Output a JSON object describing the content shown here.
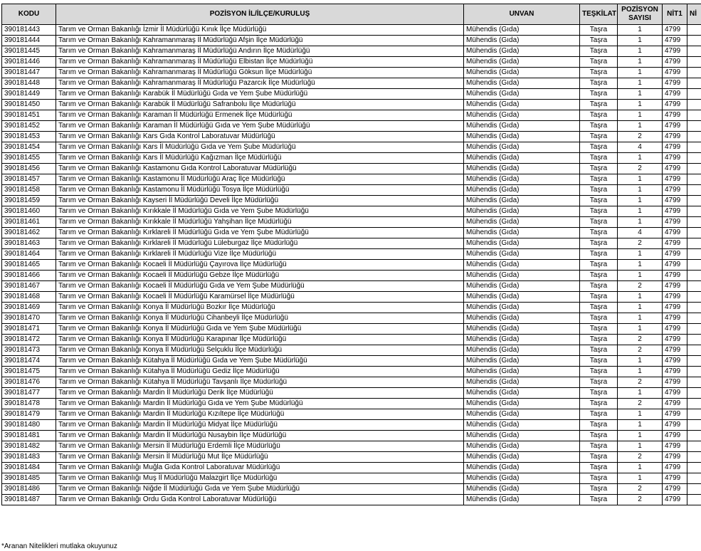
{
  "headers": {
    "kodu": "KODU",
    "pozisyon": "POZİSYON İL/İLÇE/KURULUŞ",
    "unvan": "UNVAN",
    "teskilat": "TEŞKİLAT",
    "sayisi_line1": "POZİSYON",
    "sayisi_line2": "SAYISI",
    "nit1": "NİT1",
    "nit2": "Nİ"
  },
  "rows": [
    {
      "kodu": "390181443",
      "pozisyon": "Tarım ve Orman Bakanlığı İzmir İl Müdürlüğü Kınık İlçe Müdürlüğü",
      "unvan": "Mühendis (Gıda)",
      "teskilat": "Taşra",
      "sayisi": "1",
      "nit1": "4799"
    },
    {
      "kodu": "390181444",
      "pozisyon": "Tarım ve Orman Bakanlığı Kahramanmaraş İl Müdürlüğü Afşin İlçe Müdürlüğü",
      "unvan": "Mühendis (Gıda)",
      "teskilat": "Taşra",
      "sayisi": "1",
      "nit1": "4799"
    },
    {
      "kodu": "390181445",
      "pozisyon": "Tarım ve Orman Bakanlığı Kahramanmaraş İl Müdürlüğü Andırın İlçe Müdürlüğü",
      "unvan": "Mühendis (Gıda)",
      "teskilat": "Taşra",
      "sayisi": "1",
      "nit1": "4799"
    },
    {
      "kodu": "390181446",
      "pozisyon": "Tarım ve Orman Bakanlığı Kahramanmaraş İl Müdürlüğü Elbistan İlçe Müdürlüğü",
      "unvan": "Mühendis (Gıda)",
      "teskilat": "Taşra",
      "sayisi": "1",
      "nit1": "4799"
    },
    {
      "kodu": "390181447",
      "pozisyon": "Tarım ve Orman Bakanlığı Kahramanmaraş İl Müdürlüğü Göksun İlçe Müdürlüğü",
      "unvan": "Mühendis (Gıda)",
      "teskilat": "Taşra",
      "sayisi": "1",
      "nit1": "4799"
    },
    {
      "kodu": "390181448",
      "pozisyon": "Tarım ve Orman Bakanlığı Kahramanmaraş İl Müdürlüğü Pazarcık İlçe Müdürlüğü",
      "unvan": "Mühendis (Gıda)",
      "teskilat": "Taşra",
      "sayisi": "1",
      "nit1": "4799"
    },
    {
      "kodu": "390181449",
      "pozisyon": "Tarım ve Orman Bakanlığı Karabük İl Müdürlüğü Gıda ve Yem Şube Müdürlüğü",
      "unvan": "Mühendis (Gıda)",
      "teskilat": "Taşra",
      "sayisi": "1",
      "nit1": "4799"
    },
    {
      "kodu": "390181450",
      "pozisyon": "Tarım ve Orman Bakanlığı Karabük İl Müdürlüğü Safranbolu İlçe Müdürlüğü",
      "unvan": "Mühendis (Gıda)",
      "teskilat": "Taşra",
      "sayisi": "1",
      "nit1": "4799"
    },
    {
      "kodu": "390181451",
      "pozisyon": "Tarım ve Orman Bakanlığı Karaman İl Müdürlüğü Ermenek İlçe Müdürlüğü",
      "unvan": "Mühendis (Gıda)",
      "teskilat": "Taşra",
      "sayisi": "1",
      "nit1": "4799"
    },
    {
      "kodu": "390181452",
      "pozisyon": "Tarım ve Orman Bakanlığı Karaman İl Müdürlüğü Gıda ve Yem Şube Müdürlüğü",
      "unvan": "Mühendis (Gıda)",
      "teskilat": "Taşra",
      "sayisi": "1",
      "nit1": "4799"
    },
    {
      "kodu": "390181453",
      "pozisyon": "Tarım ve Orman Bakanlığı Kars Gıda Kontrol Laboratuvar Müdürlüğü",
      "unvan": "Mühendis (Gıda)",
      "teskilat": "Taşra",
      "sayisi": "2",
      "nit1": "4799"
    },
    {
      "kodu": "390181454",
      "pozisyon": "Tarım ve Orman Bakanlığı Kars İl Müdürlüğü Gıda ve Yem Şube Müdürlüğü",
      "unvan": "Mühendis (Gıda)",
      "teskilat": "Taşra",
      "sayisi": "4",
      "nit1": "4799"
    },
    {
      "kodu": "390181455",
      "pozisyon": "Tarım ve Orman Bakanlığı Kars İl Müdürlüğü Kağızman İlçe Müdürlüğü",
      "unvan": "Mühendis (Gıda)",
      "teskilat": "Taşra",
      "sayisi": "1",
      "nit1": "4799"
    },
    {
      "kodu": "390181456",
      "pozisyon": "Tarım ve Orman Bakanlığı Kastamonu Gıda Kontrol Laboratuvar Müdürlüğü",
      "unvan": "Mühendis (Gıda)",
      "teskilat": "Taşra",
      "sayisi": "2",
      "nit1": "4799"
    },
    {
      "kodu": "390181457",
      "pozisyon": "Tarım ve Orman Bakanlığı Kastamonu İl Müdürlüğü Araç İlçe Müdürlüğü",
      "unvan": "Mühendis (Gıda)",
      "teskilat": "Taşra",
      "sayisi": "1",
      "nit1": "4799"
    },
    {
      "kodu": "390181458",
      "pozisyon": "Tarım ve Orman Bakanlığı Kastamonu İl Müdürlüğü Tosya İlçe Müdürlüğü",
      "unvan": "Mühendis (Gıda)",
      "teskilat": "Taşra",
      "sayisi": "1",
      "nit1": "4799"
    },
    {
      "kodu": "390181459",
      "pozisyon": "Tarım ve Orman Bakanlığı Kayseri İl Müdürlüğü Develi İlçe Müdürlüğü",
      "unvan": "Mühendis (Gıda)",
      "teskilat": "Taşra",
      "sayisi": "1",
      "nit1": "4799"
    },
    {
      "kodu": "390181460",
      "pozisyon": "Tarım ve Orman Bakanlığı Kırıkkale İl Müdürlüğü Gıda ve Yem Şube Müdürlüğü",
      "unvan": "Mühendis (Gıda)",
      "teskilat": "Taşra",
      "sayisi": "1",
      "nit1": "4799"
    },
    {
      "kodu": "390181461",
      "pozisyon": "Tarım ve Orman Bakanlığı Kırıkkale İl Müdürlüğü Yahşihan İlçe Müdürlüğü",
      "unvan": "Mühendis (Gıda)",
      "teskilat": "Taşra",
      "sayisi": "1",
      "nit1": "4799"
    },
    {
      "kodu": "390181462",
      "pozisyon": "Tarım ve Orman Bakanlığı Kırklareli İl Müdürlüğü Gıda ve Yem Şube Müdürlüğü",
      "unvan": "Mühendis (Gıda)",
      "teskilat": "Taşra",
      "sayisi": "4",
      "nit1": "4799"
    },
    {
      "kodu": "390181463",
      "pozisyon": "Tarım ve Orman Bakanlığı Kırklareli İl Müdürlüğü Lüleburgaz İlçe Müdürlüğü",
      "unvan": "Mühendis (Gıda)",
      "teskilat": "Taşra",
      "sayisi": "2",
      "nit1": "4799"
    },
    {
      "kodu": "390181464",
      "pozisyon": "Tarım ve Orman Bakanlığı Kırklareli İl Müdürlüğü Vize İlçe Müdürlüğü",
      "unvan": "Mühendis (Gıda)",
      "teskilat": "Taşra",
      "sayisi": "1",
      "nit1": "4799"
    },
    {
      "kodu": "390181465",
      "pozisyon": "Tarım ve Orman Bakanlığı Kocaeli İl Müdürlüğü Çayırova İlçe Müdürlüğü",
      "unvan": "Mühendis (Gıda)",
      "teskilat": "Taşra",
      "sayisi": "1",
      "nit1": "4799"
    },
    {
      "kodu": "390181466",
      "pozisyon": "Tarım ve Orman Bakanlığı Kocaeli İl Müdürlüğü Gebze İlçe Müdürlüğü",
      "unvan": "Mühendis (Gıda)",
      "teskilat": "Taşra",
      "sayisi": "1",
      "nit1": "4799"
    },
    {
      "kodu": "390181467",
      "pozisyon": "Tarım ve Orman Bakanlığı Kocaeli İl Müdürlüğü Gıda ve Yem Şube Müdürlüğü",
      "unvan": "Mühendis (Gıda)",
      "teskilat": "Taşra",
      "sayisi": "2",
      "nit1": "4799"
    },
    {
      "kodu": "390181468",
      "pozisyon": "Tarım ve Orman Bakanlığı Kocaeli İl Müdürlüğü Karamürsel İlçe Müdürlüğü",
      "unvan": "Mühendis (Gıda)",
      "teskilat": "Taşra",
      "sayisi": "1",
      "nit1": "4799"
    },
    {
      "kodu": "390181469",
      "pozisyon": "Tarım ve Orman Bakanlığı Konya İl Müdürlüğü Bozkır İlçe Müdürlüğü",
      "unvan": "Mühendis (Gıda)",
      "teskilat": "Taşra",
      "sayisi": "1",
      "nit1": "4799"
    },
    {
      "kodu": "390181470",
      "pozisyon": "Tarım ve Orman Bakanlığı Konya İl Müdürlüğü Cihanbeyli İlçe Müdürlüğü",
      "unvan": "Mühendis (Gıda)",
      "teskilat": "Taşra",
      "sayisi": "1",
      "nit1": "4799"
    },
    {
      "kodu": "390181471",
      "pozisyon": "Tarım ve Orman Bakanlığı Konya İl Müdürlüğü Gıda ve Yem Şube Müdürlüğü",
      "unvan": "Mühendis (Gıda)",
      "teskilat": "Taşra",
      "sayisi": "1",
      "nit1": "4799"
    },
    {
      "kodu": "390181472",
      "pozisyon": "Tarım ve Orman Bakanlığı Konya İl Müdürlüğü Karapınar İlçe Müdürlüğü",
      "unvan": "Mühendis (Gıda)",
      "teskilat": "Taşra",
      "sayisi": "2",
      "nit1": "4799"
    },
    {
      "kodu": "390181473",
      "pozisyon": "Tarım ve Orman Bakanlığı Konya İl Müdürlüğü Selçuklu İlçe Müdürlüğü",
      "unvan": "Mühendis (Gıda)",
      "teskilat": "Taşra",
      "sayisi": "2",
      "nit1": "4799"
    },
    {
      "kodu": "390181474",
      "pozisyon": "Tarım ve Orman Bakanlığı Kütahya İl Müdürlüğü Gıda ve Yem Şube Müdürlüğü",
      "unvan": "Mühendis (Gıda)",
      "teskilat": "Taşra",
      "sayisi": "1",
      "nit1": "4799"
    },
    {
      "kodu": "390181475",
      "pozisyon": "Tarım ve Orman Bakanlığı Kütahya İl Müdürlüğü Gediz İlçe Müdürlüğü",
      "unvan": "Mühendis (Gıda)",
      "teskilat": "Taşra",
      "sayisi": "1",
      "nit1": "4799"
    },
    {
      "kodu": "390181476",
      "pozisyon": "Tarım ve Orman Bakanlığı Kütahya İl Müdürlüğü Tavşanlı İlçe Müdürlüğü",
      "unvan": "Mühendis (Gıda)",
      "teskilat": "Taşra",
      "sayisi": "2",
      "nit1": "4799"
    },
    {
      "kodu": "390181477",
      "pozisyon": "Tarım ve Orman Bakanlığı Mardin İl Müdürlüğü Derik İlçe Müdürlüğü",
      "unvan": "Mühendis (Gıda)",
      "teskilat": "Taşra",
      "sayisi": "1",
      "nit1": "4799"
    },
    {
      "kodu": "390181478",
      "pozisyon": "Tarım ve Orman Bakanlığı Mardin İl Müdürlüğü Gıda ve Yem Şube Müdürlüğü",
      "unvan": "Mühendis (Gıda)",
      "teskilat": "Taşra",
      "sayisi": "2",
      "nit1": "4799"
    },
    {
      "kodu": "390181479",
      "pozisyon": "Tarım ve Orman Bakanlığı Mardin İl Müdürlüğü Kızıltepe İlçe Müdürlüğü",
      "unvan": "Mühendis (Gıda)",
      "teskilat": "Taşra",
      "sayisi": "1",
      "nit1": "4799"
    },
    {
      "kodu": "390181480",
      "pozisyon": "Tarım ve Orman Bakanlığı Mardin İl Müdürlüğü Midyat İlçe Müdürlüğü",
      "unvan": "Mühendis (Gıda)",
      "teskilat": "Taşra",
      "sayisi": "1",
      "nit1": "4799"
    },
    {
      "kodu": "390181481",
      "pozisyon": "Tarım ve Orman Bakanlığı Mardin İl Müdürlüğü Nusaybin İlçe Müdürlüğü",
      "unvan": "Mühendis (Gıda)",
      "teskilat": "Taşra",
      "sayisi": "1",
      "nit1": "4799"
    },
    {
      "kodu": "390181482",
      "pozisyon": "Tarım ve Orman Bakanlığı Mersin İl Müdürlüğü Erdemli İlçe Müdürlüğü",
      "unvan": "Mühendis (Gıda)",
      "teskilat": "Taşra",
      "sayisi": "1",
      "nit1": "4799"
    },
    {
      "kodu": "390181483",
      "pozisyon": "Tarım ve Orman Bakanlığı Mersin İl Müdürlüğü Mut İlçe Müdürlüğü",
      "unvan": "Mühendis (Gıda)",
      "teskilat": "Taşra",
      "sayisi": "2",
      "nit1": "4799"
    },
    {
      "kodu": "390181484",
      "pozisyon": "Tarım ve Orman Bakanlığı Muğla Gıda Kontrol Laboratuvar Müdürlüğü",
      "unvan": "Mühendis (Gıda)",
      "teskilat": "Taşra",
      "sayisi": "1",
      "nit1": "4799"
    },
    {
      "kodu": "390181485",
      "pozisyon": "Tarım ve Orman Bakanlığı Muş İl Müdürlüğü Malazgirt İlçe Müdürlüğü",
      "unvan": "Mühendis (Gıda)",
      "teskilat": "Taşra",
      "sayisi": "1",
      "nit1": "4799"
    },
    {
      "kodu": "390181486",
      "pozisyon": "Tarım ve Orman Bakanlığı Niğde İl Müdürlüğü Gıda ve Yem Şube Müdürlüğü",
      "unvan": "Mühendis (Gıda)",
      "teskilat": "Taşra",
      "sayisi": "2",
      "nit1": "4799"
    },
    {
      "kodu": "390181487",
      "pozisyon": "Tarım ve Orman Bakanlığı Ordu Gıda Kontrol Laboratuvar Müdürlüğü",
      "unvan": "Mühendis (Gıda)",
      "teskilat": "Taşra",
      "sayisi": "2",
      "nit1": "4799"
    }
  ],
  "footnote": "*Aranan Nitelikleri mutlaka okuyunuz"
}
